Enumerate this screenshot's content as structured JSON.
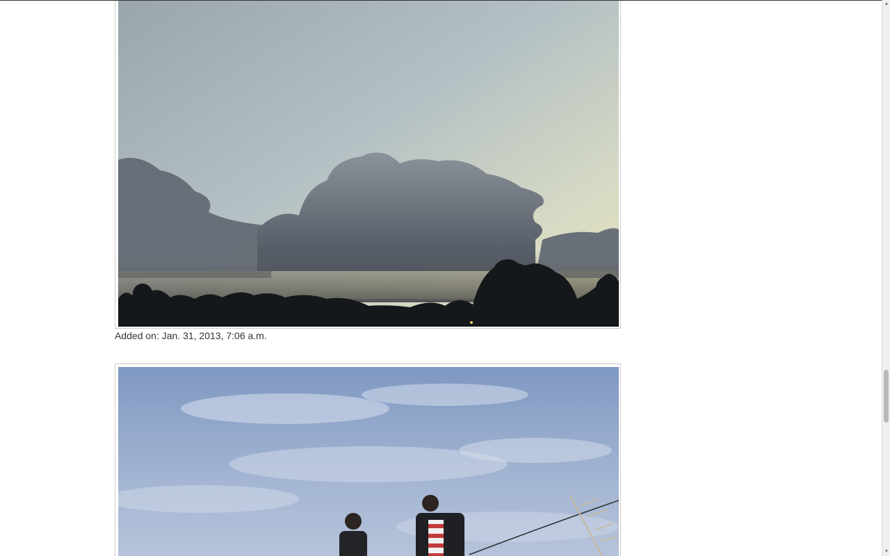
{
  "photos": [
    {
      "alt": "Cloudy evening sky over treeline",
      "caption": "Added on: Jan. 31, 2013, 7:06 a.m."
    },
    {
      "alt": "Two people standing under blue sky"
    }
  ],
  "scrollbar": {
    "up_icon": "scroll-up-arrow",
    "down_icon": "scroll-down-arrow",
    "position": 0.71
  }
}
